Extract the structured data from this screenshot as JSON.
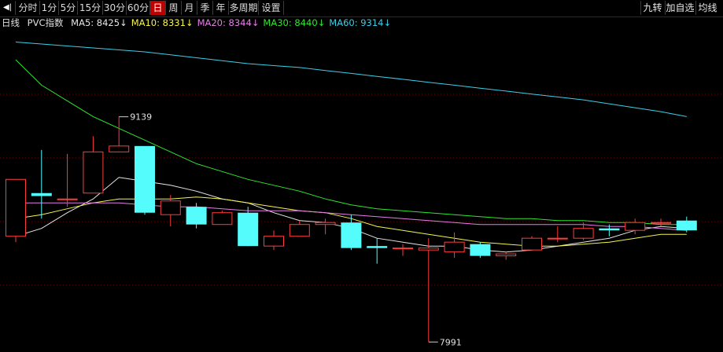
{
  "toolbar": {
    "left_items": [
      {
        "label": "分时",
        "active": false
      },
      {
        "label": "1分",
        "active": false
      },
      {
        "label": "5分",
        "active": false
      },
      {
        "label": "15分",
        "active": false
      },
      {
        "label": "30分",
        "active": false
      },
      {
        "label": "60分",
        "active": false
      },
      {
        "label": "日",
        "active": true
      },
      {
        "label": "周",
        "active": false
      },
      {
        "label": "月",
        "active": false
      },
      {
        "label": "季",
        "active": false
      },
      {
        "label": "年",
        "active": false
      },
      {
        "label": "多周期",
        "active": false
      },
      {
        "label": "设置",
        "active": false
      }
    ],
    "right_items": [
      "九转",
      "加自选",
      "均线"
    ],
    "colors": {
      "active_bg": "#c00000"
    }
  },
  "legend": {
    "period": "日线",
    "instrument": "PVC指数",
    "items": [
      {
        "label": "MA5: 8425↓",
        "color": "#e6e6e6"
      },
      {
        "label": "MA10: 8331↓",
        "color": "#f5f54a"
      },
      {
        "label": "MA20: 8344↓",
        "color": "#e87ce8"
      },
      {
        "label": "MA30: 8440↓",
        "color": "#2ee62e"
      },
      {
        "label": "MA60: 9314↓",
        "color": "#3ccfe8"
      }
    ]
  },
  "chart_data": {
    "type": "candlestick",
    "ylim": [
      7960,
      9550
    ],
    "grid": "dotted-horizontal",
    "colors": {
      "up": "#ff3c3c",
      "down": "#54fcfc",
      "grid": "#7a0000"
    },
    "candles": [
      {
        "open": 8530,
        "close": 8820,
        "high": 8820,
        "low": 8500
      },
      {
        "open": 8750,
        "close": 8735,
        "high": 8970,
        "low": 8620
      },
      {
        "open": 8720,
        "close": 8720,
        "high": 8950,
        "low": 8680
      },
      {
        "open": 8750,
        "close": 8960,
        "high": 9040,
        "low": 8750
      },
      {
        "open": 8960,
        "close": 8990,
        "high": 9139,
        "low": 8960
      },
      {
        "open": 8990,
        "close": 8650,
        "high": 8990,
        "low": 8640
      },
      {
        "open": 8640,
        "close": 8710,
        "high": 8740,
        "low": 8580
      },
      {
        "open": 8680,
        "close": 8590,
        "high": 8700,
        "low": 8570
      },
      {
        "open": 8590,
        "close": 8650,
        "high": 8660,
        "low": 8590
      },
      {
        "open": 8650,
        "close": 8480,
        "high": 8680,
        "low": 8480
      },
      {
        "open": 8480,
        "close": 8530,
        "high": 8560,
        "low": 8460
      },
      {
        "open": 8530,
        "close": 8590,
        "high": 8610,
        "low": 8530
      },
      {
        "open": 8590,
        "close": 8600,
        "high": 8620,
        "low": 8540
      },
      {
        "open": 8600,
        "close": 8470,
        "high": 8640,
        "low": 8460
      },
      {
        "open": 8480,
        "close": 8470,
        "high": 8520,
        "low": 8390
      },
      {
        "open": 8470,
        "close": 8470,
        "high": 8490,
        "low": 8430
      },
      {
        "open": 8460,
        "close": 8470,
        "high": 8520,
        "low": 7991
      },
      {
        "open": 8450,
        "close": 8500,
        "high": 8550,
        "low": 8420
      },
      {
        "open": 8490,
        "close": 8430,
        "high": 8500,
        "low": 8420
      },
      {
        "open": 8430,
        "close": 8440,
        "high": 8450,
        "low": 8410
      },
      {
        "open": 8460,
        "close": 8520,
        "high": 8530,
        "low": 8460
      },
      {
        "open": 8520,
        "close": 8520,
        "high": 8580,
        "low": 8500
      },
      {
        "open": 8520,
        "close": 8570,
        "high": 8600,
        "low": 8510
      },
      {
        "open": 8570,
        "close": 8560,
        "high": 8590,
        "low": 8530
      },
      {
        "open": 8560,
        "close": 8600,
        "high": 8620,
        "low": 8540
      },
      {
        "open": 8600,
        "close": 8600,
        "high": 8620,
        "low": 8580
      },
      {
        "open": 8610,
        "close": 8560,
        "high": 8630,
        "low": 8550
      }
    ],
    "ma_series": [
      {
        "name": "MA5",
        "color": "#e6e6e6",
        "values": [
          8530,
          8570,
          8650,
          8720,
          8830,
          8810,
          8790,
          8760,
          8720,
          8700,
          8650,
          8610,
          8600,
          8570,
          8520,
          8500,
          8480,
          8480,
          8460,
          8450,
          8460,
          8480,
          8500,
          8520,
          8560,
          8580,
          8570
        ]
      },
      {
        "name": "MA10",
        "color": "#f5f54a",
        "values": [
          8620,
          8640,
          8670,
          8700,
          8720,
          8720,
          8720,
          8730,
          8720,
          8700,
          8680,
          8660,
          8650,
          8620,
          8580,
          8560,
          8540,
          8520,
          8500,
          8490,
          8480,
          8480,
          8490,
          8500,
          8520,
          8540,
          8540
        ]
      },
      {
        "name": "MA20",
        "color": "#e87ce8",
        "values": [
          8700,
          8700,
          8700,
          8700,
          8700,
          8690,
          8680,
          8680,
          8670,
          8660,
          8660,
          8660,
          8650,
          8640,
          8630,
          8620,
          8610,
          8600,
          8590,
          8590,
          8590,
          8590,
          8590,
          8580,
          8580,
          8570,
          8560
        ]
      },
      {
        "name": "MA30",
        "color": "#2ee62e",
        "values": [
          9430,
          9300,
          9220,
          9140,
          9080,
          9020,
          8960,
          8900,
          8860,
          8820,
          8790,
          8760,
          8720,
          8690,
          8670,
          8660,
          8650,
          8640,
          8630,
          8620,
          8620,
          8610,
          8610,
          8600,
          8600,
          8590,
          8590
        ]
      },
      {
        "name": "MA60",
        "color": "#3ccfe8",
        "values": [
          9520,
          9510,
          9500,
          9490,
          9480,
          9470,
          9455,
          9440,
          9425,
          9410,
          9400,
          9390,
          9375,
          9360,
          9345,
          9330,
          9315,
          9300,
          9285,
          9270,
          9255,
          9240,
          9225,
          9205,
          9185,
          9165,
          9140
        ]
      }
    ],
    "annotations": [
      {
        "label": "9139",
        "candle": 4,
        "value": 9139,
        "side": "right"
      },
      {
        "label": "7991",
        "candle": 16,
        "value": 7991,
        "side": "right"
      }
    ]
  }
}
